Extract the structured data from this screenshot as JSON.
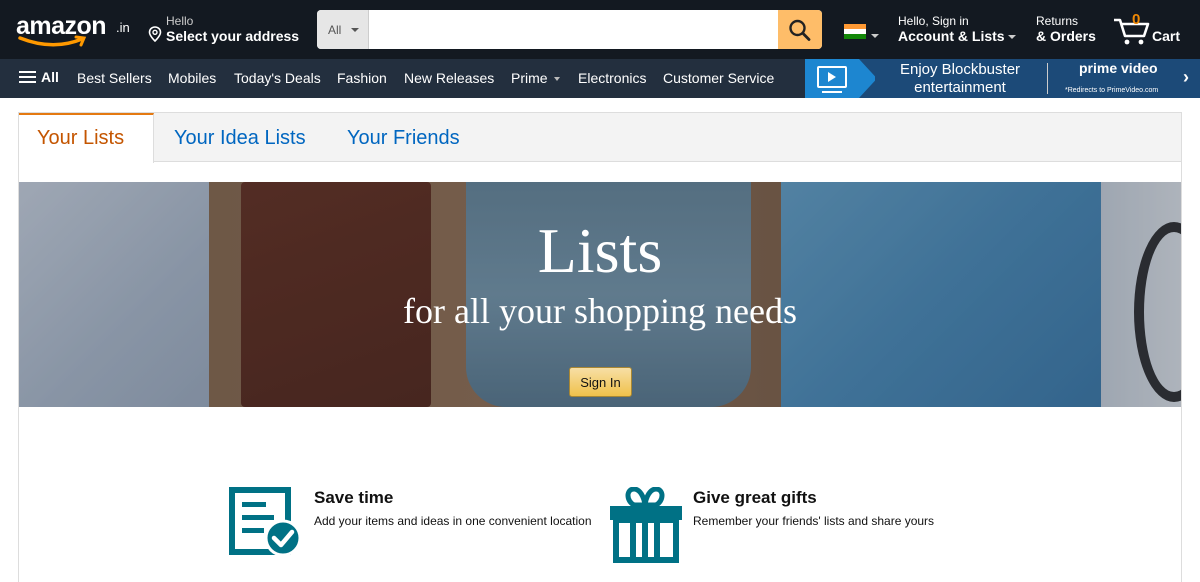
{
  "header": {
    "logo_text": "amazon",
    "logo_tld": ".in",
    "address_line1": "Hello",
    "address_line2": "Select your address",
    "search_category": "All",
    "search_placeholder": "",
    "account_line1": "Hello, Sign in",
    "account_line2": "Account & Lists",
    "returns_line1": "Returns",
    "returns_line2": "& Orders",
    "cart_count": "0",
    "cart_label": "Cart"
  },
  "nav": {
    "all_label": "All",
    "items": [
      "Best Sellers",
      "Mobiles",
      "Today's Deals",
      "Fashion",
      "New Releases",
      "Prime",
      "Electronics",
      "Customer Service"
    ]
  },
  "promo": {
    "line1": "Enjoy Blockbuster",
    "line2": "entertainment",
    "brand": "prime video",
    "note": "*Redirects to PrimeVideo.com"
  },
  "tabs": [
    "Your Lists",
    "Your Idea Lists",
    "Your Friends"
  ],
  "hero": {
    "title": "Lists",
    "subtitle": "for all your shopping needs",
    "button": "Sign In"
  },
  "features": [
    {
      "title": "Save time",
      "desc": "Add your items and ideas in one convenient location"
    },
    {
      "title": "Give great gifts",
      "desc": "Remember your friends' lists and share yours"
    }
  ],
  "colors": {
    "header_bg": "#131921",
    "nav_bg": "#232f3e",
    "search_button": "#febd69",
    "active_tab": "#c45500",
    "link": "#0066c0",
    "feature_icon": "#007185"
  }
}
